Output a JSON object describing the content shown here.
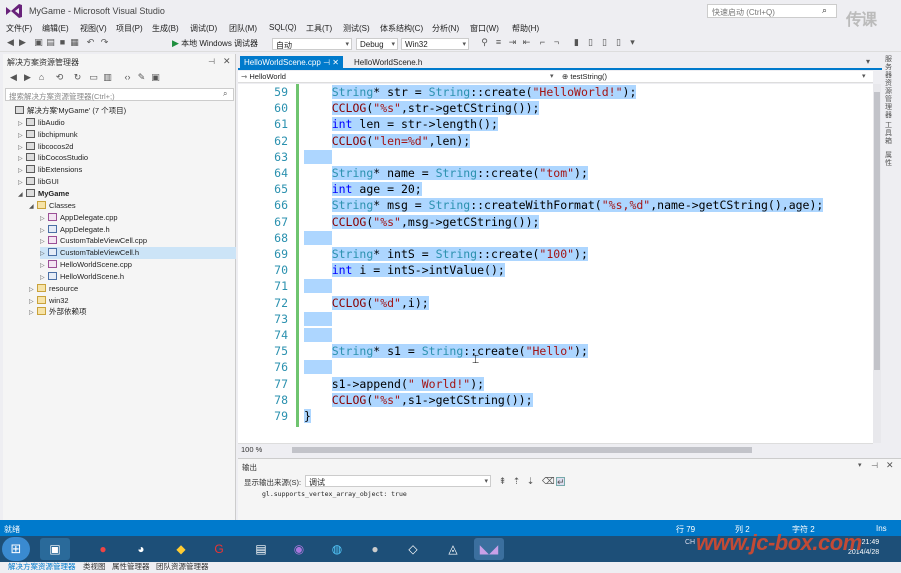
{
  "window": {
    "title": "MyGame - Microsoft Visual Studio",
    "quick_launch_placeholder": "快速启动 (Ctrl+Q)",
    "brand_text": "传课"
  },
  "menu": [
    "文件(F)",
    "编辑(E)",
    "视图(V)",
    "项目(P)",
    "生成(B)",
    "调试(D)",
    "团队(M)",
    "SQL(Q)",
    "工具(T)",
    "测试(S)",
    "体系结构(C)",
    "分析(N)",
    "窗口(W)",
    "帮助(H)"
  ],
  "toolbar": {
    "run_label": "本地 Windows 调试器",
    "mode": "自动",
    "config": "Debug",
    "platform": "Win32"
  },
  "solution_explorer": {
    "title": "解决方案资源管理器",
    "search_placeholder": "搜索解决方案资源管理器(Ctrl+;)",
    "items": [
      {
        "label": "解决方案'MyGame' (7 个项目)",
        "indent": 0,
        "icon": "solution"
      },
      {
        "label": "libAudio",
        "indent": 1,
        "icon": "proj"
      },
      {
        "label": "libchipmunk",
        "indent": 1,
        "icon": "proj"
      },
      {
        "label": "libcocos2d",
        "indent": 1,
        "icon": "proj"
      },
      {
        "label": "libCocosStudio",
        "indent": 1,
        "icon": "proj"
      },
      {
        "label": "libExtensions",
        "indent": 1,
        "icon": "proj"
      },
      {
        "label": "libGUI",
        "indent": 1,
        "icon": "proj"
      },
      {
        "label": "MyGame",
        "indent": 1,
        "icon": "proj"
      },
      {
        "label": "Classes",
        "indent": 2,
        "icon": "folder"
      },
      {
        "label": "AppDelegate.cpp",
        "indent": 3,
        "icon": "cpp"
      },
      {
        "label": "AppDelegate.h",
        "indent": 3,
        "icon": "h"
      },
      {
        "label": "CustomTableViewCell.cpp",
        "indent": 3,
        "icon": "cpp"
      },
      {
        "label": "CustomTableViewCell.h",
        "indent": 3,
        "icon": "h"
      },
      {
        "label": "HelloWorldScene.cpp",
        "indent": 3,
        "icon": "cpp"
      },
      {
        "label": "HelloWorldScene.h",
        "indent": 3,
        "icon": "h"
      },
      {
        "label": "resource",
        "indent": 2,
        "icon": "folder"
      },
      {
        "label": "win32",
        "indent": 2,
        "icon": "folder"
      },
      {
        "label": "外部依赖项",
        "indent": 2,
        "icon": "folder"
      }
    ],
    "bottom_tabs": [
      "解决方案资源管理器",
      "类视图",
      "属性管理器",
      "团队资源管理器"
    ]
  },
  "editor": {
    "tabs": [
      "HelloWorldScene.cpp",
      "HelloWorldScene.h"
    ],
    "nav_scope": "HelloWorld",
    "nav_member": "testString()",
    "zoom": "100 %",
    "lines": [
      {
        "n": "59",
        "code": "    String* str = String::create(\"HelloWorld!\");"
      },
      {
        "n": "60",
        "code": "    CCLOG(\"%s\",str->getCString());"
      },
      {
        "n": "61",
        "code": "    int len = str->length();"
      },
      {
        "n": "62",
        "code": "    CCLOG(\"len=%d\",len);"
      },
      {
        "n": "63",
        "code": ""
      },
      {
        "n": "64",
        "code": "    String* name = String::create(\"tom\");"
      },
      {
        "n": "65",
        "code": "    int age = 20;"
      },
      {
        "n": "66",
        "code": "    String* msg = String::createWithFormat(\"%s,%d\",name->getCString(),age);"
      },
      {
        "n": "67",
        "code": "    CCLOG(\"%s\",msg->getCString());"
      },
      {
        "n": "68",
        "code": ""
      },
      {
        "n": "69",
        "code": "    String* intS = String::create(\"100\");"
      },
      {
        "n": "70",
        "code": "    int i = intS->intValue();"
      },
      {
        "n": "71",
        "code": ""
      },
      {
        "n": "72",
        "code": "    CCLOG(\"%d\",i);"
      },
      {
        "n": "73",
        "code": ""
      },
      {
        "n": "74",
        "code": ""
      },
      {
        "n": "75",
        "code": "    String* s1 = String::create(\"Hello\");"
      },
      {
        "n": "76",
        "code": ""
      },
      {
        "n": "77",
        "code": "    s1->append(\" World!\");"
      },
      {
        "n": "78",
        "code": "    CCLOG(\"%s\",s1->getCString());"
      },
      {
        "n": "79",
        "code": "}"
      }
    ]
  },
  "output": {
    "title": "输出",
    "source_label": "显示输出来源(S):",
    "source_value": "调试",
    "text": "gl.supports_vertex_array_object: true"
  },
  "status": {
    "ready": "就绪",
    "row": "行 79",
    "col": "列 2",
    "char": "字符 2",
    "mode": "Ins"
  },
  "taskbar": {
    "ime": "CH",
    "time": "21:49",
    "date": "2014/4/28",
    "watermark": "www.jc-box.com"
  },
  "right_rail": [
    "服务器资源管理器",
    "工具箱",
    "属性"
  ]
}
